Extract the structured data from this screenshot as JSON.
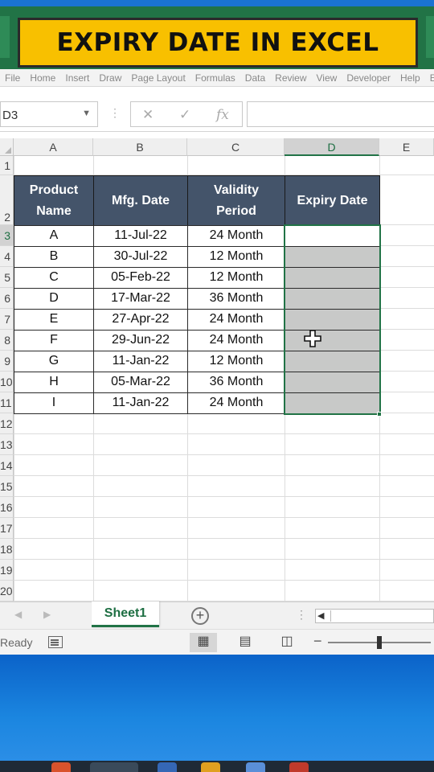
{
  "banner": {
    "title": "EXPIRY DATE IN EXCEL"
  },
  "ribbon": {
    "tabs": [
      "File",
      "Home",
      "Insert",
      "Draw",
      "Page Layout",
      "Formulas",
      "Data",
      "Review",
      "View",
      "Developer",
      "Help",
      "Enter"
    ]
  },
  "formula_bar": {
    "name_box": "D3",
    "name_box_arrow": "▼",
    "separator": "⋮",
    "cancel_symbol": "✕",
    "enter_symbol": "✓",
    "fx_symbol": "fx",
    "formula": ""
  },
  "grid": {
    "columns": [
      "A",
      "B",
      "C",
      "D",
      "E"
    ],
    "rows": [
      "1",
      "2",
      "3",
      "4",
      "5",
      "6",
      "7",
      "8",
      "9",
      "10",
      "11",
      "12",
      "13",
      "14",
      "15",
      "16",
      "17",
      "18",
      "19",
      "20"
    ],
    "selected_column": "D",
    "selected_cell": "D3"
  },
  "table": {
    "headers": {
      "product": "Product Name",
      "mfg": "Mfg. Date",
      "validity": "Validity Period",
      "expiry": "Expiry Date"
    },
    "rows": [
      {
        "product": "A",
        "mfg": "11-Jul-22",
        "validity": "24 Month",
        "expiry": ""
      },
      {
        "product": "B",
        "mfg": "30-Jul-22",
        "validity": "12 Month",
        "expiry": ""
      },
      {
        "product": "C",
        "mfg": "05-Feb-22",
        "validity": "12 Month",
        "expiry": ""
      },
      {
        "product": "D",
        "mfg": "17-Mar-22",
        "validity": "36 Month",
        "expiry": ""
      },
      {
        "product": "E",
        "mfg": "27-Apr-22",
        "validity": "24 Month",
        "expiry": ""
      },
      {
        "product": "F",
        "mfg": "29-Jun-22",
        "validity": "24 Month",
        "expiry": ""
      },
      {
        "product": "G",
        "mfg": "11-Jan-22",
        "validity": "12 Month",
        "expiry": ""
      },
      {
        "product": "H",
        "mfg": "05-Mar-22",
        "validity": "36 Month",
        "expiry": ""
      },
      {
        "product": "I",
        "mfg": "11-Jan-22",
        "validity": "24 Month",
        "expiry": ""
      }
    ]
  },
  "sheet_tabs": {
    "prev": "◀",
    "next": "▶",
    "active": "Sheet1",
    "add_symbol": "+",
    "dots": "⋮",
    "scroll_left": "◀"
  },
  "status_bar": {
    "ready": "Ready",
    "normal_view_icon": "▦",
    "page_layout_icon": "▤",
    "page_break_icon": "◫",
    "zoom_minus": "−"
  },
  "colors": {
    "excel_green": "#217346",
    "header_fill": "#44546a",
    "banner_yellow": "#f8c000",
    "selection_fill": "#c8c9c8"
  }
}
